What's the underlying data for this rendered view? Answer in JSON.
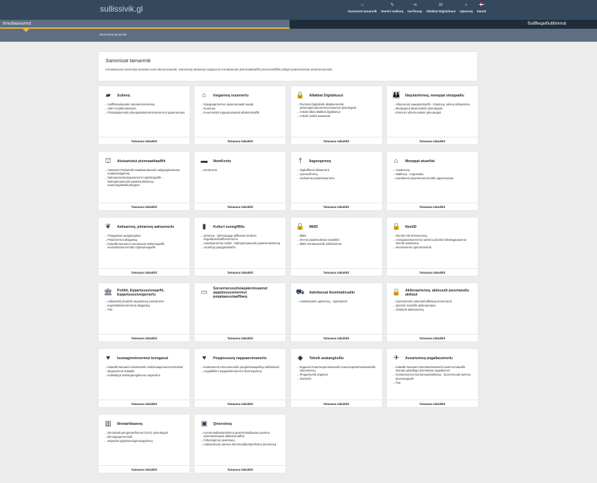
{
  "header": {
    "site_name": "sullissivik.gl",
    "overlay_text": "Sammisat tamarmik - Timitalimmik ingerlatsineq",
    "nav": [
      {
        "icon": "home-icon",
        "glyph": "⌂",
        "label": "Sammisat tamarmik"
      },
      {
        "icon": "doc-icon",
        "glyph": "✎",
        "label": "Immini sullineq"
      },
      {
        "icon": "login-icon",
        "glyph": "⇥",
        "label": "Iserfissaq"
      },
      {
        "icon": "mail-icon",
        "glyph": "✉",
        "label": "Allakkat Digitaliusut"
      },
      {
        "icon": "search-icon",
        "glyph": "⌕",
        "label": "Ujaarneq"
      },
      {
        "icon": "flag-icon",
        "glyph": "",
        "label": "Dansk"
      }
    ]
  },
  "tabs": {
    "left": "Innuttaasumut",
    "right": "Suliffeqarfiutilimmut"
  },
  "breadcrumb": "Sammisat tamarmik",
  "intro": {
    "title": "Sammisat tamarmik",
    "text": "Innuttaasunut sammisat tamaasa uani takuarmaavatit. Sammisaq atasassq toqqaruniu innuttaasutut pisinnaatitaaffiit pissusissaffiillu pillugit paasissutissat atuarsinnaavatit."
  },
  "cards": [
    {
      "icon": "briefcase-icon",
      "glyph": "▰",
      "title": "Sulineq",
      "links": [
        "Suliffissaalejaatut naluna­ersornee­raq",
        "AMA-mi pilikoriassarnt",
        "Pisinatigisorumik pineqaatissarnerisma­rnermut uppernarsaat"
      ],
      "cta": "Tamaasa takukkit"
    },
    {
      "icon": "house-icon",
      "glyph": "⌂",
      "title": "Inegarneq nuunnerlu",
      "links": [
        "Najugaqarnermut uppernarsaatit aaquk",
        "Nuunneq",
        "Nuunnissinit eqqaamasassat allattorsimaffik"
      ],
      "cta": "Tamaasa takukkit"
    },
    {
      "icon": "lock-icon",
      "glyph": "🔒",
      "title": "Allakkat Digitaliusut",
      "links": [
        "Pisortani Digitalimik allakkerm­ernik pissarsiginnaannermerma­sumut qinnutegarit",
        "e-Boks-ikkut allakkat digitaliusut",
        "e-Boks maliut atuasavat"
      ],
      "cta": "Tamaasa takukkit"
    },
    {
      "icon": "family-icon",
      "glyph": "👪",
      "title": "Ilaqutariinneq, meeqqat utoqqaallu",
      "links": [
        "Ulluunerani paaqqinnittarfiit - Iniusineq, arineq aktitaarneru",
        "Meeqqanut aktarusulinik qinnutegarit",
        "Eminernt ulloornusianik qinnutegarit"
      ],
      "cta": "Tamaasa takukkit"
    },
    {
      "icon": "bank-icon",
      "glyph": "⛫",
      "title": "Atuisartutut pisinnaatitaaffiit",
      "links": [
        "Atuisartut Pisisartullu Maalaarutaannik Aalajangiisartunut maalaarutigameq",
        "Naluna­erarsautiaqaramernt Aqutsisoqarfik - Nalinginnaasumik paasissutissinneq naammagittaalliuutegartu"
      ],
      "cta": "Tamaasa takukkit"
    },
    {
      "icon": "card-icon",
      "glyph": "▬",
      "title": "NemKonto",
      "links": [
        "NemKonto"
      ],
      "cta": "Tamaasa takukkit"
    },
    {
      "icon": "cross-icon",
      "glyph": "†",
      "title": "Ilageeqarneq",
      "links": [
        "Oqaluffimmi ilisisarnerit",
        "Aperserfinneq",
        "Atelisarneq kulatsissarnerlu"
      ],
      "cta": "Tamaasa takukkit"
    },
    {
      "icon": "school-icon",
      "glyph": "⌂",
      "title": "Meeqqat atuarfiat",
      "links": [
        "Atualerneq",
        "Natilineq - Angusaaka",
        "Karakteerit atuarsinnarnermullu uppernarsaat"
      ],
      "cta": "Tamaasa takukkit"
    },
    {
      "icon": "plant-icon",
      "glyph": "❦",
      "title": "Aalisarneq, piniarneq aalisarnerlu",
      "links": [
        "Piniagassat aasiginngitsut",
        "Piniarnermut allagartaq",
        "Kalaallit Nunaanni Uumasunut Nakorsaqarfik inussuttissarnermullu Oqartussaqarfik"
      ],
      "cta": "Tamaasa takukkit"
    },
    {
      "icon": "book-icon",
      "glyph": "▮",
      "title": "Kulturi sunngiffillu",
      "links": [
        "Qimmeq - Qimmiaqqap piffissami siullerni angarlanissinaffimminnerra",
        "Aasassanermut sulluit - Nalinginnaasumik paasissutissinneq",
        "Atuarfiup paaqqinnittarfia"
      ],
      "cta": "Tamaasa takukkit"
    },
    {
      "icon": "lock-icon",
      "glyph": "🔒",
      "title": "MitID",
      "links": [
        "MitID",
        "ID-mut paasissutissat nutarikkit",
        "MitID Innuttaasumik sullissivimmi"
      ],
      "cta": "Tamaasa takukkit"
    },
    {
      "icon": "lock-icon",
      "glyph": "🔒",
      "title": "NemID",
      "links": [
        "NemID-mik innimminneq",
        "Aningaasarsiornernut aamma pisortat nittartagaasannut NemID atassuseq",
        "Iserniarnermi ajornartorsiutit"
      ],
      "cta": "Tamaasa takukkit"
    },
    {
      "icon": "parliament-icon",
      "glyph": "🏛",
      "title": "Polititi, Eqqartuussiveqarfit, Eqqartuussiveqarnerlu",
      "links": [
        "Aallaasinik pinutinik eqqussineq annissinerlu",
        "Ingerlatitsiissnarnernut allagartaq",
        "Pas"
      ],
      "cta": "Tamaasa takukkit"
    },
    {
      "icon": "paper-icon",
      "glyph": "▭",
      "title": "Sorsernerusutisiaqalernissamut aappiisuussinermut peqataassutaaffiaeq",
      "links": [],
      "cta": "Tamaasa takukkit"
    },
    {
      "icon": "cart-icon",
      "glyph": "⛟",
      "title": "Aatsitassat ikummatissallu",
      "links": [
        "Aatsitassanik ujarterneq - Ujarassiorit"
      ],
      "cta": "Tamaasa takukkit"
    },
    {
      "icon": "lock-icon",
      "glyph": "🔒",
      "title": "Akileraarteneq, akitsuutit pisortanullu akiliaut",
      "links": [
        "Sumiorlunnik nalunaarsuiffissaq immersoruk",
        "Qamutit motorillit akileraarutaat",
        "Akiliarnik akileraarneq"
      ],
      "cta": "Tamaasa takukkit"
    },
    {
      "icon": "heart-icon",
      "glyph": "♥",
      "title": "Isumaginninnermut tunngasut",
      "links": [
        "Kalaallit Nunaanni siusissamik sulisinnaajunnaernersiutisiat",
        "Ilaqutarinnut suliaalik",
        "Inatsidligut atasiaqarnigitsunut naqsersiut"
      ],
      "cta": "Tamaasa takukkit"
    },
    {
      "icon": "health-icon",
      "glyph": "♥",
      "title": "Peqqissuseq nappaarsimanerlu",
      "links": [
        "Naartusunut errisuussunullu peqqinnissaqarfiup sullisisissai",
        "Angalalliluni nappaarsimanermi ikiorneqarneq"
      ],
      "cta": "Tamaasa takukkit"
    },
    {
      "icon": "drop-icon",
      "glyph": "◆",
      "title": "Teknik avatangiisillu",
      "links": [
        "Eqqaanit imaarneqarnissaannik imaarneqartarinnissaannillu nalunaarneq",
        "Pingaartumik angissut",
        "NunaGIS"
      ],
      "cta": "Tamaasa takukkit"
    },
    {
      "icon": "plane-icon",
      "glyph": "✈",
      "title": "Assartuineq angallassinerlu",
      "links": [
        "Kalaallit Nunaanni timmisartussamerit aamma Kalaallit Nunaat qulaallugu timmisartut angallanneri",
        "Imarsiornernut isumannaassutissaq - Siunnersuutit aamma piumasaqaatit",
        "Pas"
      ],
      "cta": "Tamaasa takukkit"
    },
    {
      "icon": "library-icon",
      "glyph": "▥",
      "title": "Ilinniartitaaneq",
      "links": [
        "Ilinniartarfuunngorsarfimmut (GUX) qinnutegarit",
        "Ilinniagaqarnersiutit",
        "Majoriani pigimisaningiinssappimeq"
      ],
      "cta": "Tamaasa takukkit"
    },
    {
      "icon": "govt-icon",
      "glyph": "▣",
      "title": "Qinersineq",
      "links": [
        "Kommunalbestyrelsimut qinersinissallaaneq aamma qinersisinnaasut allattorsimaffiat",
        "Folketingimut qinersineq",
        "Inatsisartunut aamma kommunalbestyrelsimut qinersineq"
      ],
      "cta": "Tamaasa takukkit"
    }
  ]
}
